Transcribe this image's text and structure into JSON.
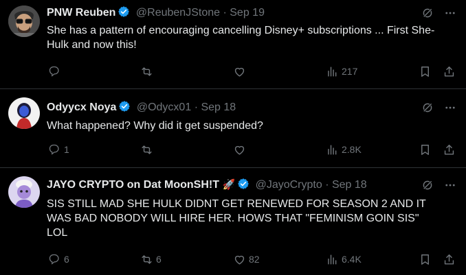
{
  "tweets": [
    {
      "name": "PNW Reuben",
      "handle": "@ReubenJStone",
      "sep": "·",
      "date": "Sep 19",
      "text": "She has a pattern of encouraging cancelling Disney+ subscriptions ... First She-Hulk and now this!",
      "replies": "",
      "reposts": "",
      "likes": "",
      "views": "217"
    },
    {
      "name": "Odyycx Noya",
      "handle": "@Odycx01",
      "sep": "·",
      "date": "Sep 18",
      "text": "What happened? Why did it get suspended?",
      "replies": "1",
      "reposts": "",
      "likes": "",
      "views": "2.8K"
    },
    {
      "name": "JAYO CRYPTO on Dat MoonSH!T",
      "name_emoji": "🚀",
      "handle": "@JayoCrypto",
      "sep": "·",
      "date": "Sep 18",
      "text": "SIS STILL MAD SHE HULK DIDNT GET RENEWED FOR SEASON 2 AND IT WAS BAD NOBODY WILL HIRE HER. HOWS THAT \"FEMINISM GOIN SIS\" LOL",
      "replies": "6",
      "reposts": "6",
      "likes": "82",
      "views": "6.4K"
    }
  ],
  "colors": {
    "verified": "#1d9bf0",
    "muted": "#71767b",
    "text": "#e7e9ea",
    "divider": "#2f3336"
  },
  "icons": [
    "reply-icon",
    "repost-icon",
    "like-icon",
    "views-icon",
    "bookmark-icon",
    "share-icon",
    "grok-icon",
    "more-icon",
    "verified-badge-icon"
  ]
}
